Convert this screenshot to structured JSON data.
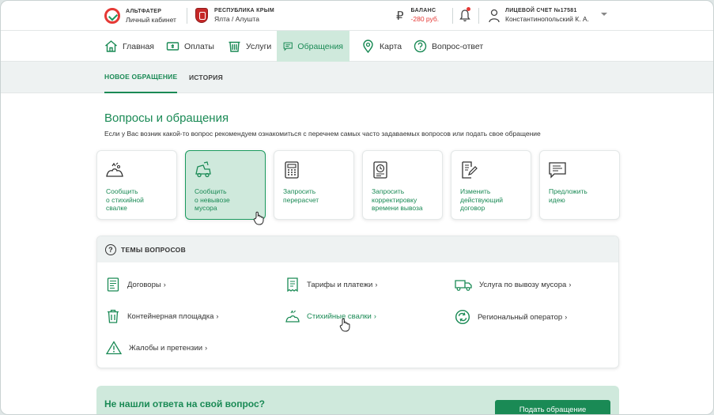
{
  "header": {
    "brand": {
      "name": "АЛЬТФАТЕР",
      "subtitle": "Личный кабинет"
    },
    "region": {
      "name": "РЕСПУБЛИКА КРЫМ",
      "city": "Ялта / Алушта"
    },
    "balance": {
      "label": "БАЛАНС",
      "value": "-280 руб.",
      "currency_symbol": "₽"
    },
    "account": {
      "label": "ЛИЦЕВОЙ СЧЕТ №17581",
      "name": "Константинопольский К. А."
    }
  },
  "nav": {
    "items": [
      {
        "label": "Главная",
        "icon": "home-icon"
      },
      {
        "label": "Оплаты",
        "icon": "payment-icon"
      },
      {
        "label": "Услуги",
        "icon": "services-icon"
      },
      {
        "label": "Обращения",
        "icon": "chat-icon",
        "active": true
      },
      {
        "label": "Карта",
        "icon": "map-pin-icon"
      },
      {
        "label": "Вопрос-ответ",
        "icon": "question-icon"
      }
    ]
  },
  "subtabs": [
    {
      "label": "НОВОЕ ОБРАЩЕНИЕ",
      "active": true
    },
    {
      "label": "ИСТОРИЯ"
    }
  ],
  "page": {
    "title": "Вопросы и обращения",
    "subtitle": "Если у Вас возник какой-то вопрос рекомендуем ознакомиться с перечнем самых часто задаваемых вопросов или подать свое обращение"
  },
  "cards": [
    {
      "label": "Сообщить\nо стихийной\nсвалке",
      "icon": "trash-pile-icon"
    },
    {
      "label": "Сообщить\nо невывозе\nмусора",
      "icon": "garbage-truck-icon",
      "active": true
    },
    {
      "label": "Запросить\nперерасчет",
      "icon": "calculator-icon"
    },
    {
      "label": "Запросить\nкорректировку\nвремени вывоза",
      "icon": "clock-document-icon"
    },
    {
      "label": "Изменить\nдействующий\nдоговор",
      "icon": "edit-document-icon"
    },
    {
      "label": "Предложить\nидею",
      "icon": "message-idea-icon"
    }
  ],
  "topics": {
    "title": "ТЕМЫ ВОПРОСОВ",
    "items": [
      {
        "label": "Договоры",
        "icon": "contract-icon"
      },
      {
        "label": "Тарифы и платежи",
        "icon": "receipt-icon"
      },
      {
        "label": "Услуга по вывозу мусора",
        "icon": "truck-icon"
      },
      {
        "label": "Контейнерная площадка",
        "icon": "bin-icon"
      },
      {
        "label": "Стихийные свалки",
        "icon": "trash-pile-icon",
        "active": true
      },
      {
        "label": "Региональный оператор",
        "icon": "recycle-icon"
      },
      {
        "label": "Жалобы и претензии",
        "icon": "warning-icon"
      }
    ],
    "chevron": "›"
  },
  "banner": {
    "text": "Не нашли ответа на свой вопрос?",
    "button": "Подать обращение"
  },
  "colors": {
    "accent": "#1a8a55",
    "accent_light": "#cfe9dc",
    "alert": "#e53935"
  }
}
